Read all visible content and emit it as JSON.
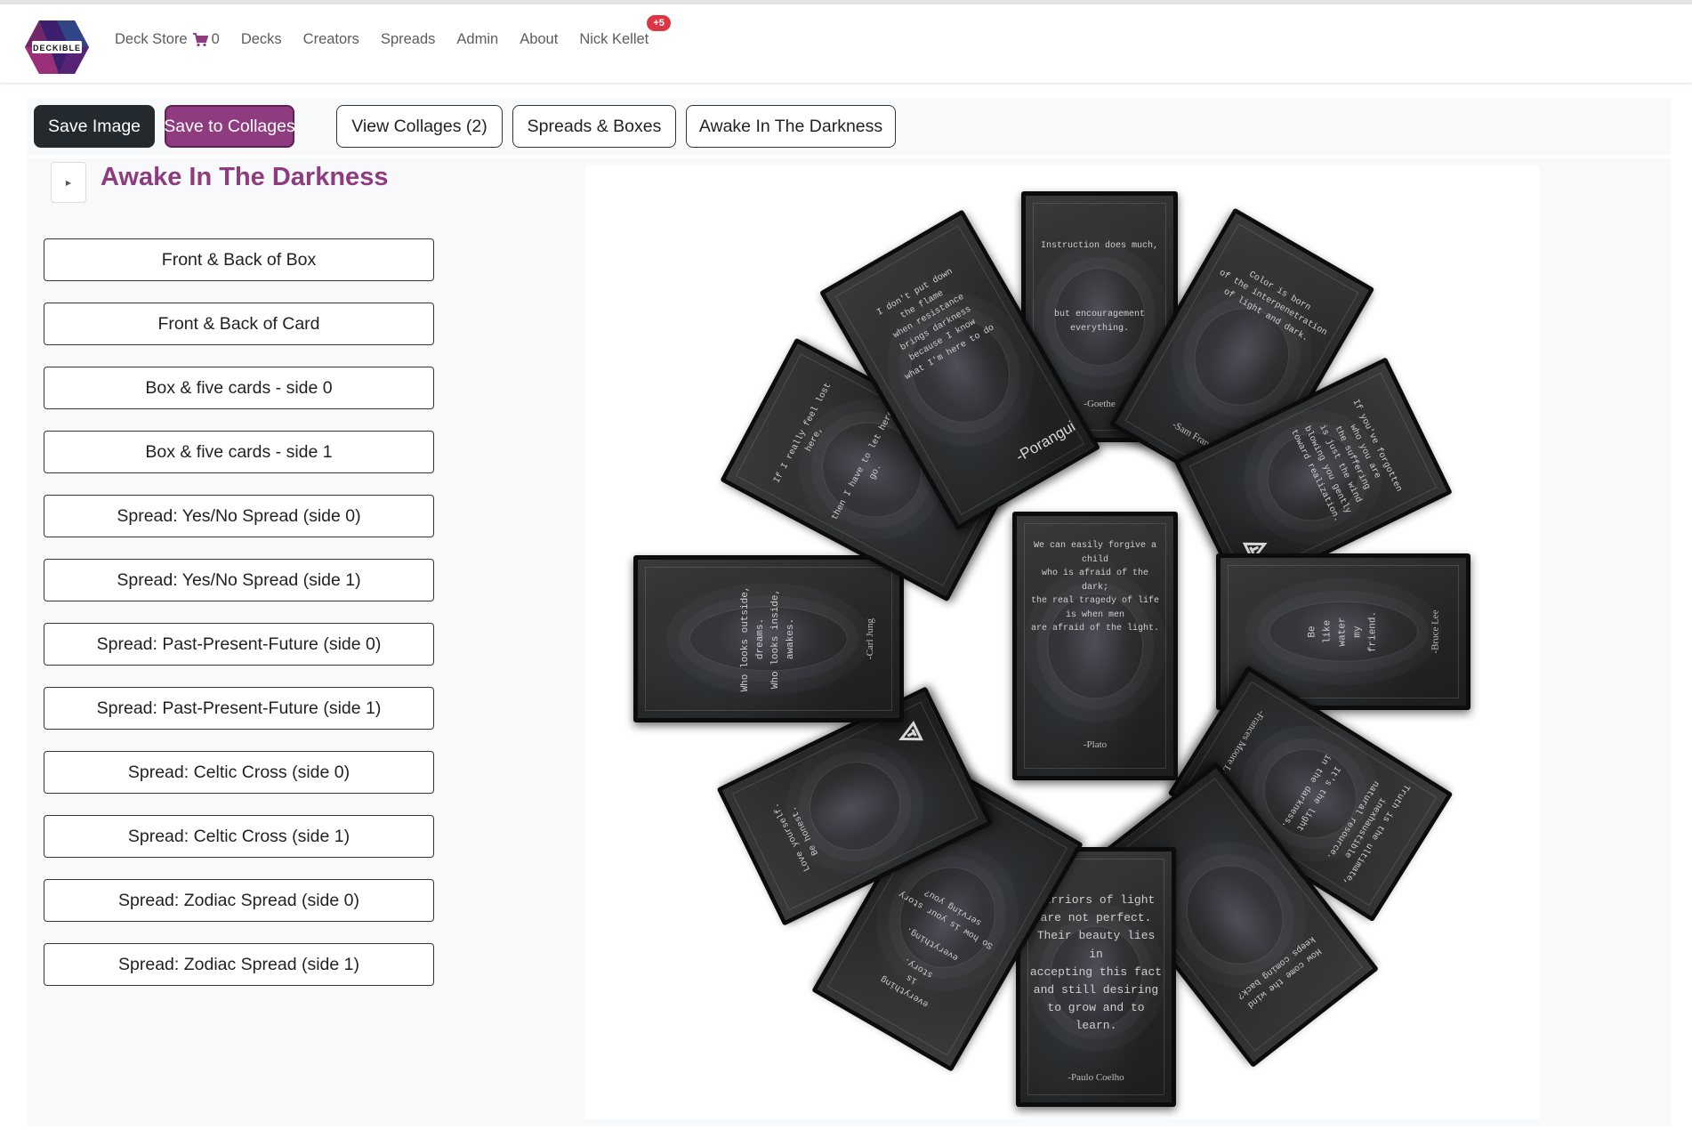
{
  "nav": {
    "brand": "DECKIBLE",
    "deck_store": "Deck Store",
    "cart_count": "0",
    "decks": "Decks",
    "creators": "Creators",
    "spreads": "Spreads",
    "admin": "Admin",
    "about": "About",
    "user": "Nick Kellet",
    "notification_badge": "+5"
  },
  "toolbar": {
    "save_image": "Save Image",
    "save_to_collages": "Save to Collages",
    "view_collages": "View Collages (2)",
    "spreads_boxes": "Spreads & Boxes",
    "deck_name": "Awake In The Darkness"
  },
  "sidebar": {
    "title": "Awake In The Darkness",
    "toggle_icon": "caret-right-icon",
    "items": [
      "Front & Back of Box",
      "Front & Back of Card",
      "Box & five cards - side 0",
      "Box & five cards - side 1",
      "Spread: Yes/No Spread (side 0)",
      "Spread: Yes/No Spread (side 1)",
      "Spread: Past-Present-Future (side 0)",
      "Spread: Past-Present-Future (side 1)",
      "Spread: Celtic Cross (side 0)",
      "Spread: Celtic Cross (side 1)",
      "Spread: Zodiac Spread (side 0)",
      "Spread: Zodiac Spread (side 1)"
    ]
  },
  "cards": [
    {
      "quote": "Instruction does much,\n\n\n\n\nbut encouragement everything.",
      "author": "-Goethe"
    },
    {
      "quote": "Color is born\nof the interpenetration\nof light and dark.",
      "author": "-Sam Francis"
    },
    {
      "quote": "If you've forgotten\nwho you are\nthe suffering\nis just the wind\nblowing you gently\ntoward realization.",
      "author": ""
    },
    {
      "quote": "Be\nlike\nwater\nmy\nfriend.",
      "author": "-Bruce Lee"
    },
    {
      "quote": "Truth is the ultimate,\ninexhaustible\nnatural resource.\n\n\nIt's the light\nin the darkness.",
      "author": "-Frances Moore Lappé"
    },
    {
      "quote": "How come the wind\nkeeps coming back?",
      "author": ""
    },
    {
      "quote": "Warriors of light\nare not perfect.\nTheir beauty lies in\naccepting this fact\nand still desiring\nto grow and to learn.",
      "author": "-Paulo Coelho"
    },
    {
      "quote": "everything\nis\nstory.\n\neverything.\n\nSo how is your story\nserving you?",
      "author": ""
    },
    {
      "quote": "Love yourself.\nBe honest.",
      "author": ""
    },
    {
      "quote": "Who looks outside, dreams.\nWho looks inside, awakes.",
      "author": "-Carl Jung"
    },
    {
      "quote": "If I really feel lost here,\n\n\n\nthen I have to let here go.",
      "author": ""
    },
    {
      "quote": "I don't put down\nthe flame\nwhen resistance\nbrings darkness\nbecause I know\nwhat I'm here to do",
      "author": "-Porangui"
    },
    {
      "quote": "We can easily forgive a child\nwho is afraid of the dark;\nthe real tragedy of life\nis when men\nare afraid of the light.",
      "author": "-Plato"
    }
  ]
}
